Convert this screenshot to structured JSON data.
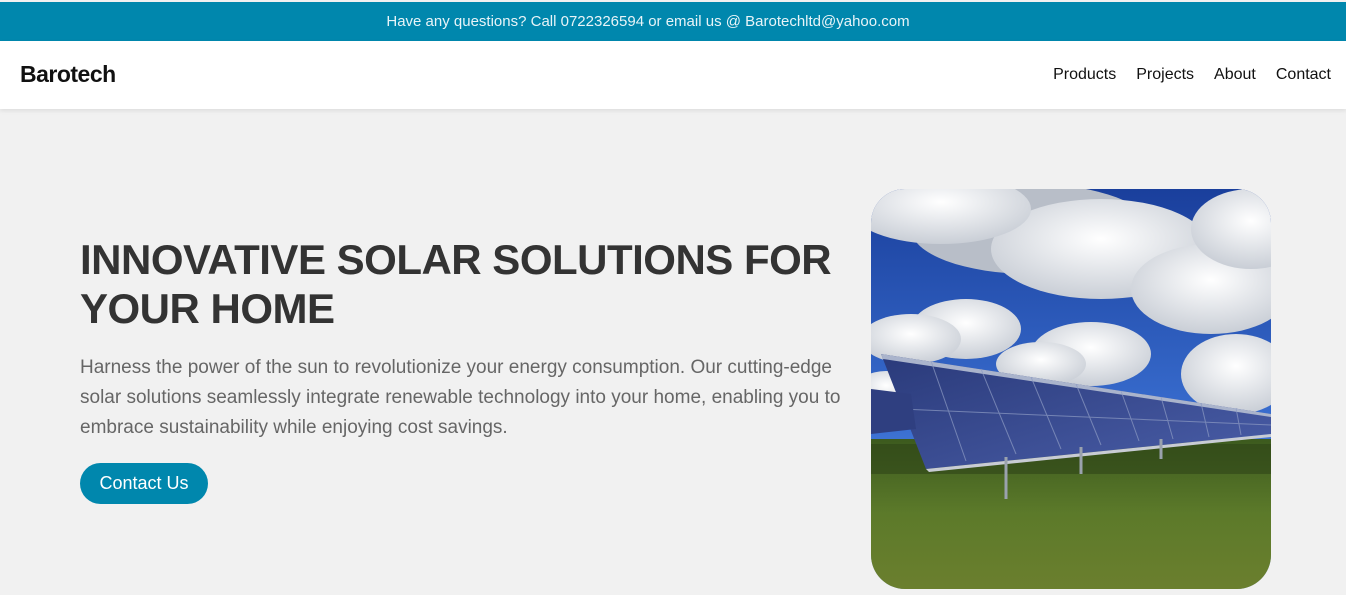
{
  "topbar": {
    "message": "Have any questions? Call 0722326594 or email us @ Barotechltd@yahoo.com"
  },
  "navbar": {
    "brand": "Barotech",
    "links": [
      {
        "label": "Products"
      },
      {
        "label": "Projects"
      },
      {
        "label": "About"
      },
      {
        "label": "Contact"
      }
    ]
  },
  "hero": {
    "title": "INNOVATIVE SOLAR SOLUTIONS FOR YOUR HOME",
    "description": "Harness the power of the sun to revolutionize your energy consumption. Our cutting-edge solar solutions seamlessly integrate renewable technology into your home, enabling you to embrace sustainability while enjoying cost savings.",
    "cta_label": "Contact Us"
  },
  "colors": {
    "accent": "#0087ad",
    "page_background": "#f1f1f1",
    "heading": "#333333",
    "body_text": "#666666"
  }
}
